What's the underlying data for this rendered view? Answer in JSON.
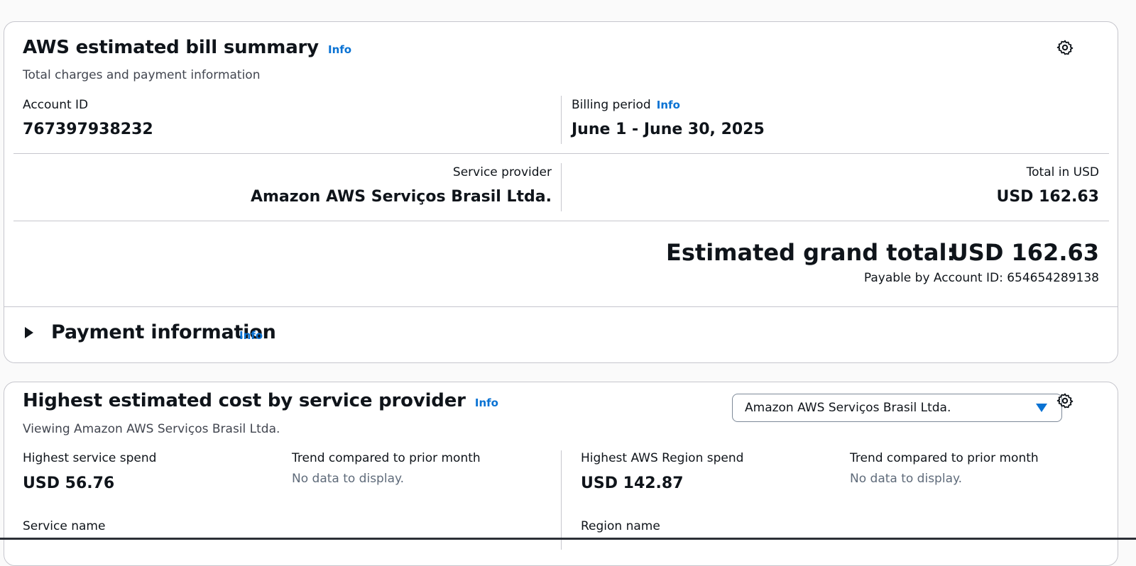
{
  "bill_summary": {
    "title": "AWS estimated bill summary",
    "info": "Info",
    "subtitle": "Total charges and payment information",
    "account_id_label": "Account ID",
    "account_id_value": "767397938232",
    "billing_period_label": "Billing period",
    "billing_period_info": "Info",
    "billing_period_value": "June 1 - June 30, 2025",
    "service_provider_label": "Service provider",
    "service_provider_value": "Amazon AWS Serviços Brasil Ltda.",
    "total_usd_label": "Total in USD",
    "total_usd_value": "USD 162.63",
    "grand_total_label": "Estimated grand total:",
    "grand_total_value": "USD 162.63",
    "payable_by": "Payable by Account ID: 654654289138",
    "payment_info_title": "Payment information",
    "payment_info_info": "Info"
  },
  "highest_cost": {
    "title": "Highest estimated cost by service provider",
    "info": "Info",
    "subtitle": "Viewing Amazon AWS Serviços Brasil Ltda.",
    "select_value": "Amazon AWS Serviços Brasil Ltda.",
    "highest_service_label": "Highest service spend",
    "highest_service_value": "USD 56.76",
    "trend_label_1": "Trend compared to prior month",
    "trend_value_1": "No data to display.",
    "highest_region_label": "Highest AWS Region spend",
    "highest_region_value": "USD 142.87",
    "trend_label_2": "Trend compared to prior month",
    "trend_value_2": "No data to display.",
    "service_name_label": "Service name",
    "region_name_label": "Region name"
  },
  "icons": {
    "settings": "gear-icon",
    "expand": "caret-right-icon",
    "dropdown": "caret-down-icon"
  },
  "colors": {
    "link": "#0972d3",
    "border": "#c6c6cd",
    "text": "#0f141a"
  }
}
